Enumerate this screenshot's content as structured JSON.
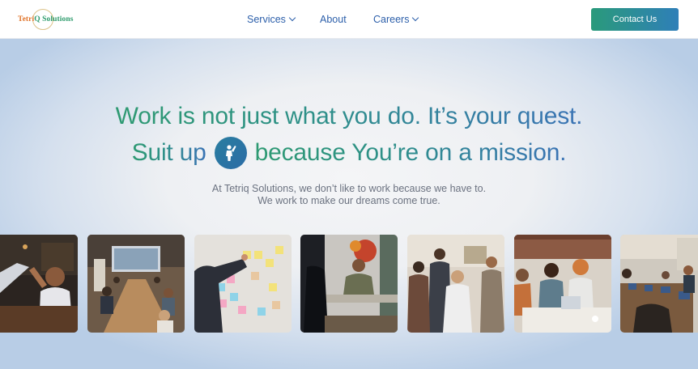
{
  "header": {
    "logo_text_a": "Tetri",
    "logo_text_b": "Q Solutions",
    "nav": [
      {
        "label": "Services",
        "has_dropdown": true
      },
      {
        "label": "About",
        "has_dropdown": false
      },
      {
        "label": "Careers",
        "has_dropdown": true
      }
    ],
    "cta_label": "Contact Us"
  },
  "hero": {
    "headline_line1": "Work is not just what you do. It’s your quest.",
    "headline_line2_a": "Suit up",
    "headline_line2_b": "because You’re on a mission.",
    "subtext_line1": "At Tetriq Solutions, we don’t like to work because we have to.",
    "subtext_line2": "We work to make our dreams come true."
  },
  "photos": [
    {
      "icon": "team-high-five-photo"
    },
    {
      "icon": "conference-room-photo"
    },
    {
      "icon": "sticky-notes-board-photo"
    },
    {
      "icon": "office-meeting-photo"
    },
    {
      "icon": "team-group-photo"
    },
    {
      "icon": "laptop-collaboration-photo"
    },
    {
      "icon": "coworking-space-photo"
    }
  ],
  "colors": {
    "brand_green": "#2e9a72",
    "brand_blue": "#3a73b5",
    "nav_text": "#2c5faa",
    "subtext": "#6b7280"
  }
}
